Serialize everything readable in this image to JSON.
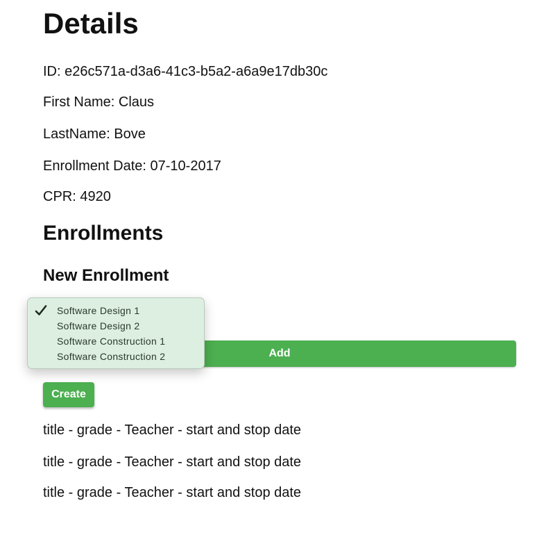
{
  "page_title": "Details",
  "details": {
    "id": "ID: e26c571a-d3a6-41c3-b5a2-a6a9e17db30c",
    "first_name": "First Name: Claus",
    "last_name": "LastName: Bove",
    "enrollment_date": "Enrollment Date: 07-10-2017",
    "cpr": "CPR: 4920"
  },
  "enrollments_title": "Enrollments",
  "new_enrollment": {
    "title": "New Enrollment",
    "selected_option": "Software Design 1",
    "options": [
      "Software Design 1",
      "Software Design 2",
      "Software Construction 1",
      "Software Construction 2"
    ],
    "add_label": "Add"
  },
  "create_label": "Create",
  "enrollment_items": [
    "title - grade - Teacher - start and stop date",
    "title - grade - Teacher - start and stop date",
    "title - grade - Teacher - start and stop date"
  ],
  "colors": {
    "button_green": "#4caf50",
    "dropdown_bg": "#dcefe0"
  },
  "icons": {
    "selected_check": "check-icon"
  }
}
